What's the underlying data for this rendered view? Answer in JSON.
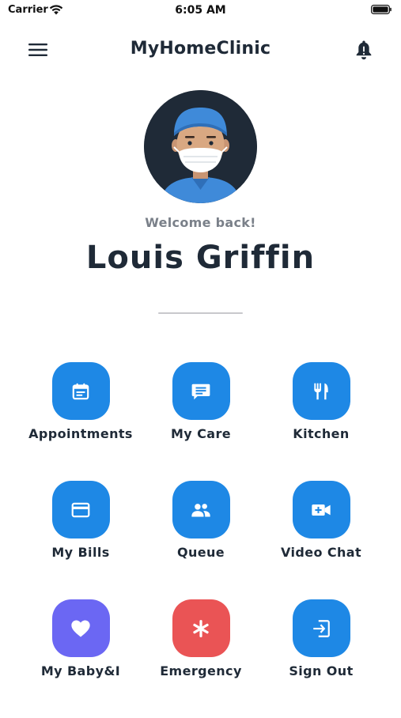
{
  "status_bar": {
    "carrier": "Carrier",
    "time": "6:05 AM"
  },
  "nav": {
    "title": "MyHomeClinic",
    "menu_icon": "hamburger-menu-icon",
    "bell_icon": "bell-icon"
  },
  "profile": {
    "welcome": "Welcome back!",
    "name": "Louis Griffin"
  },
  "colors": {
    "primary": "#1e88e5",
    "purple": "#6b67f3",
    "red": "#ea5455",
    "text": "#1f2a37",
    "muted": "#7a8089"
  },
  "menu": {
    "items": [
      {
        "label": "Appointments",
        "icon": "calendar-icon"
      },
      {
        "label": "My Care",
        "icon": "chat-icon"
      },
      {
        "label": "Kitchen",
        "icon": "utensils-icon"
      },
      {
        "label": "My Bills",
        "icon": "credit-card-icon"
      },
      {
        "label": "Queue",
        "icon": "people-icon"
      },
      {
        "label": "Video Chat",
        "icon": "video-camera-icon"
      },
      {
        "label": "My Baby&I",
        "icon": "heart-icon"
      },
      {
        "label": "Emergency",
        "icon": "asterisk-icon"
      },
      {
        "label": "Sign Out",
        "icon": "sign-out-icon"
      }
    ]
  }
}
